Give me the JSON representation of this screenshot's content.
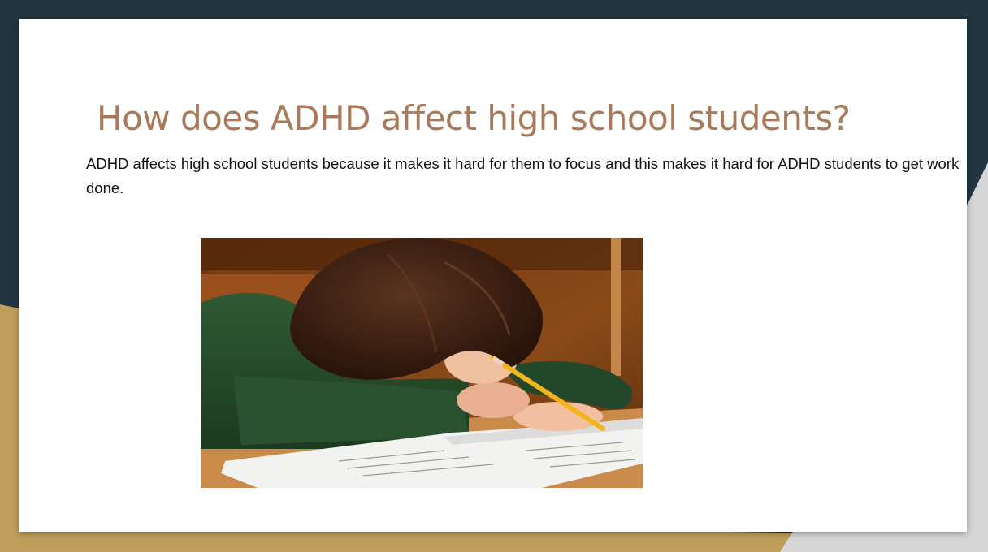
{
  "slide": {
    "title": "How does ADHD affect high school students?",
    "body": "ADHD affects high school students because it makes it hard for them to focus and this makes it hard for ADHD students to get work done."
  },
  "photo": {
    "subject": "student with head down writing in a workbook with a pencil"
  },
  "theme": {
    "dark_background": "#223540",
    "gold_accent": "#bf9e5c",
    "gray_accent": "#d6d6d6",
    "title_color": "#a9795a"
  }
}
